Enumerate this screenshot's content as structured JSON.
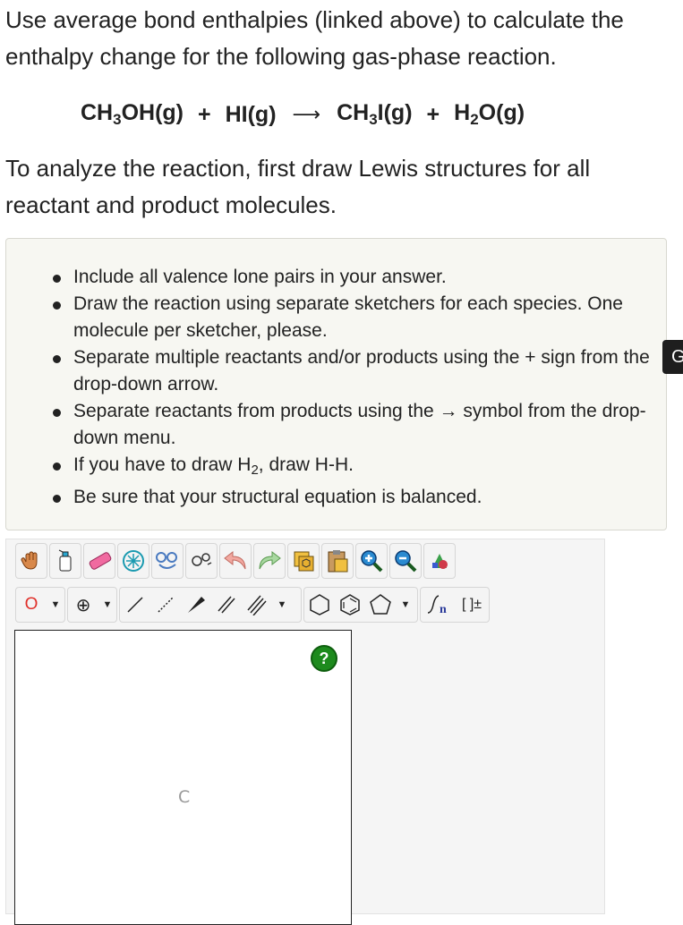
{
  "intro_text": "Use average bond enthalpies (linked above) to calculate the enthalpy change for the following gas-phase reaction.",
  "reaction": {
    "r1_a": "CH",
    "r1_sub": "3",
    "r1_b": "OH(g)",
    "plus1": "+",
    "r2": "HI(g)",
    "arrow": "⟶",
    "p1_a": "CH",
    "p1_sub": "3",
    "p1_b": "I(g)",
    "plus2": "+",
    "p2_a": "H",
    "p2_sub": "2",
    "p2_b": "O(g)"
  },
  "analyze_text": "To analyze the reaction, first draw Lewis structures for all reactant and product molecules.",
  "instructions": {
    "item1": "Include all valence lone pairs in your answer.",
    "item2": "Draw the reaction using separate sketchers for each species. One molecule per sketcher, please.",
    "item3": "Separate multiple reactants and/or products using the + sign from the drop-down arrow.",
    "item4": "Separate reactants from products using the → symbol from the drop-down menu.",
    "item5_a": "If you have to draw H",
    "item5_sub": "2",
    "item5_b": ", draw H-H.",
    "item6": "Be sure that your structural equation is balanced."
  },
  "side_tab_label": "G",
  "sketcher": {
    "atom_selector": "O",
    "charge_label": "⊕",
    "sgroup_label": "n",
    "bracket_label": "[ ]±",
    "help_label": "?",
    "canvas_atom": "C",
    "icons": [
      "hand-icon",
      "erase-bottle-icon",
      "eraser-icon",
      "lasso-icon",
      "clean-icon",
      "template-icon",
      "undo-icon",
      "redo-icon",
      "copy-icon",
      "paste-icon",
      "zoom-in-icon",
      "zoom-out-icon",
      "color-icon"
    ]
  }
}
